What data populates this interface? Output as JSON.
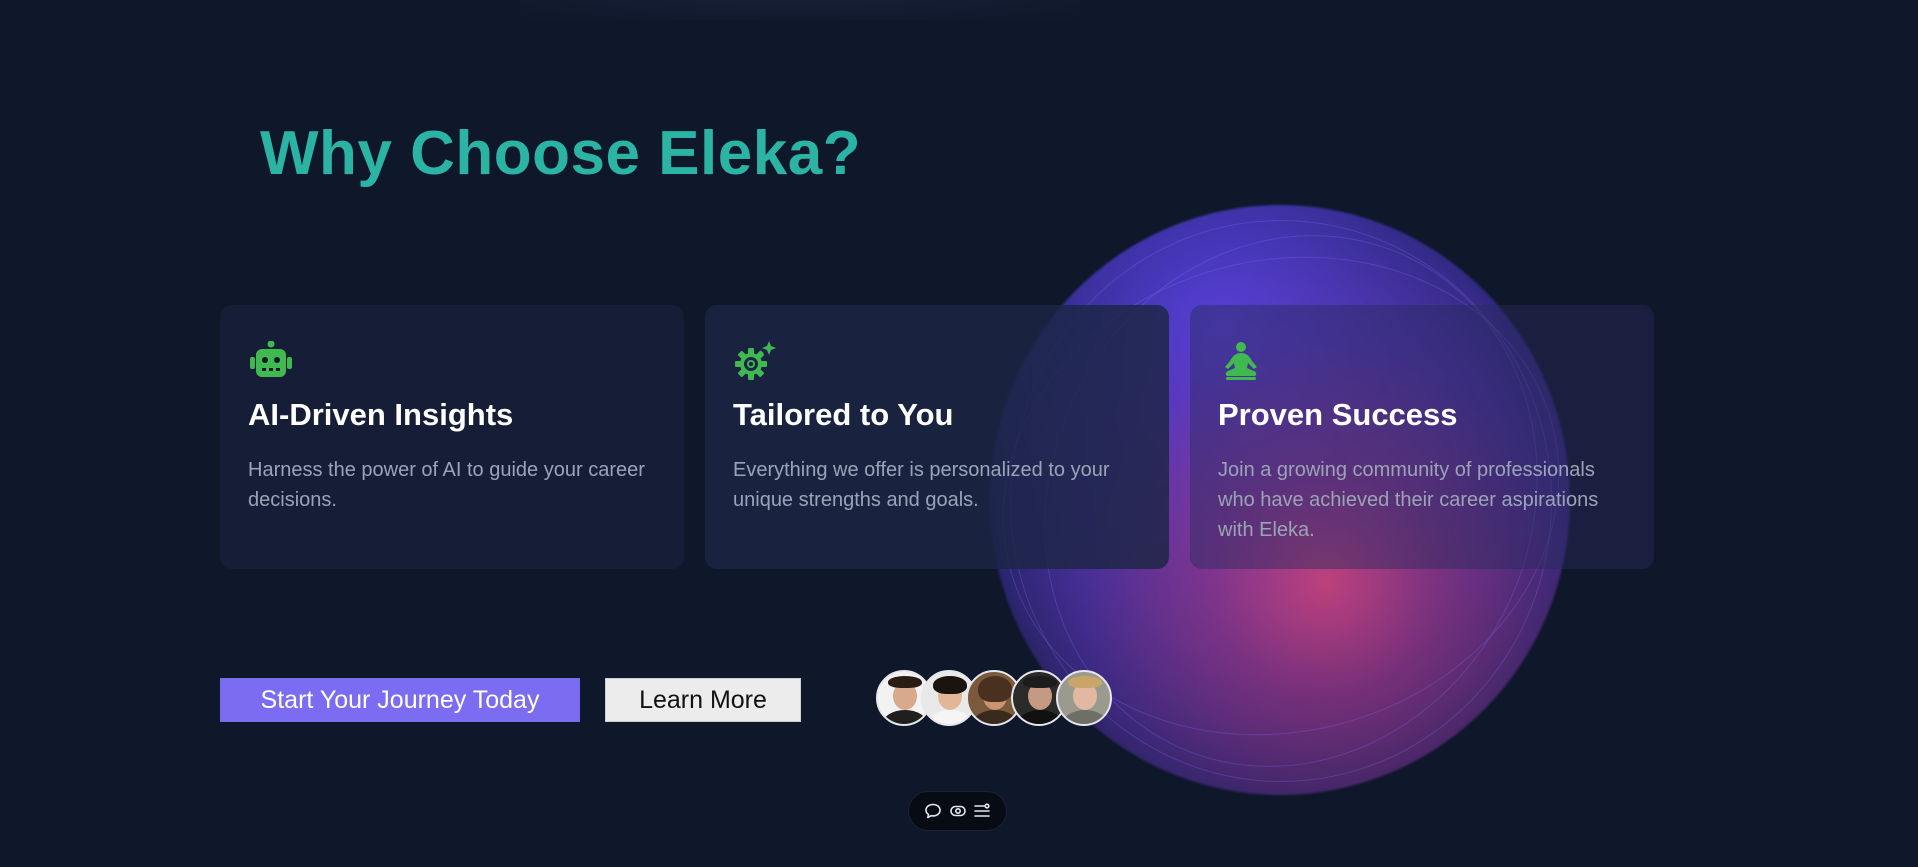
{
  "section": {
    "heading": "Why Choose Eleka?"
  },
  "features": [
    {
      "icon": "robot-icon",
      "title": "AI-Driven Insights",
      "description": "Harness the power of AI to guide your career decisions."
    },
    {
      "icon": "gear-sparkle-icon",
      "title": "Tailored to You",
      "description": "Everything we offer is personalized to your unique strengths and goals."
    },
    {
      "icon": "meditation-icon",
      "title": "Proven Success",
      "description": "Join a growing community of professionals who have achieved their career aspirations with Eleka."
    }
  ],
  "cta": {
    "primary_label": "Start Your Journey Today",
    "secondary_label": "Learn More"
  },
  "avatars": [
    "avatar-1",
    "avatar-2",
    "avatar-3",
    "avatar-4",
    "avatar-5"
  ],
  "toolbar": {
    "items": [
      "comment-icon",
      "eye-icon",
      "settings-list-icon"
    ]
  },
  "colors": {
    "background": "#0f172a",
    "heading": "#2bb3a4",
    "icon_green": "#3fb950",
    "primary_button": "#7c6cf2",
    "secondary_button": "#ececec",
    "card_text": "#9aa4b6"
  }
}
